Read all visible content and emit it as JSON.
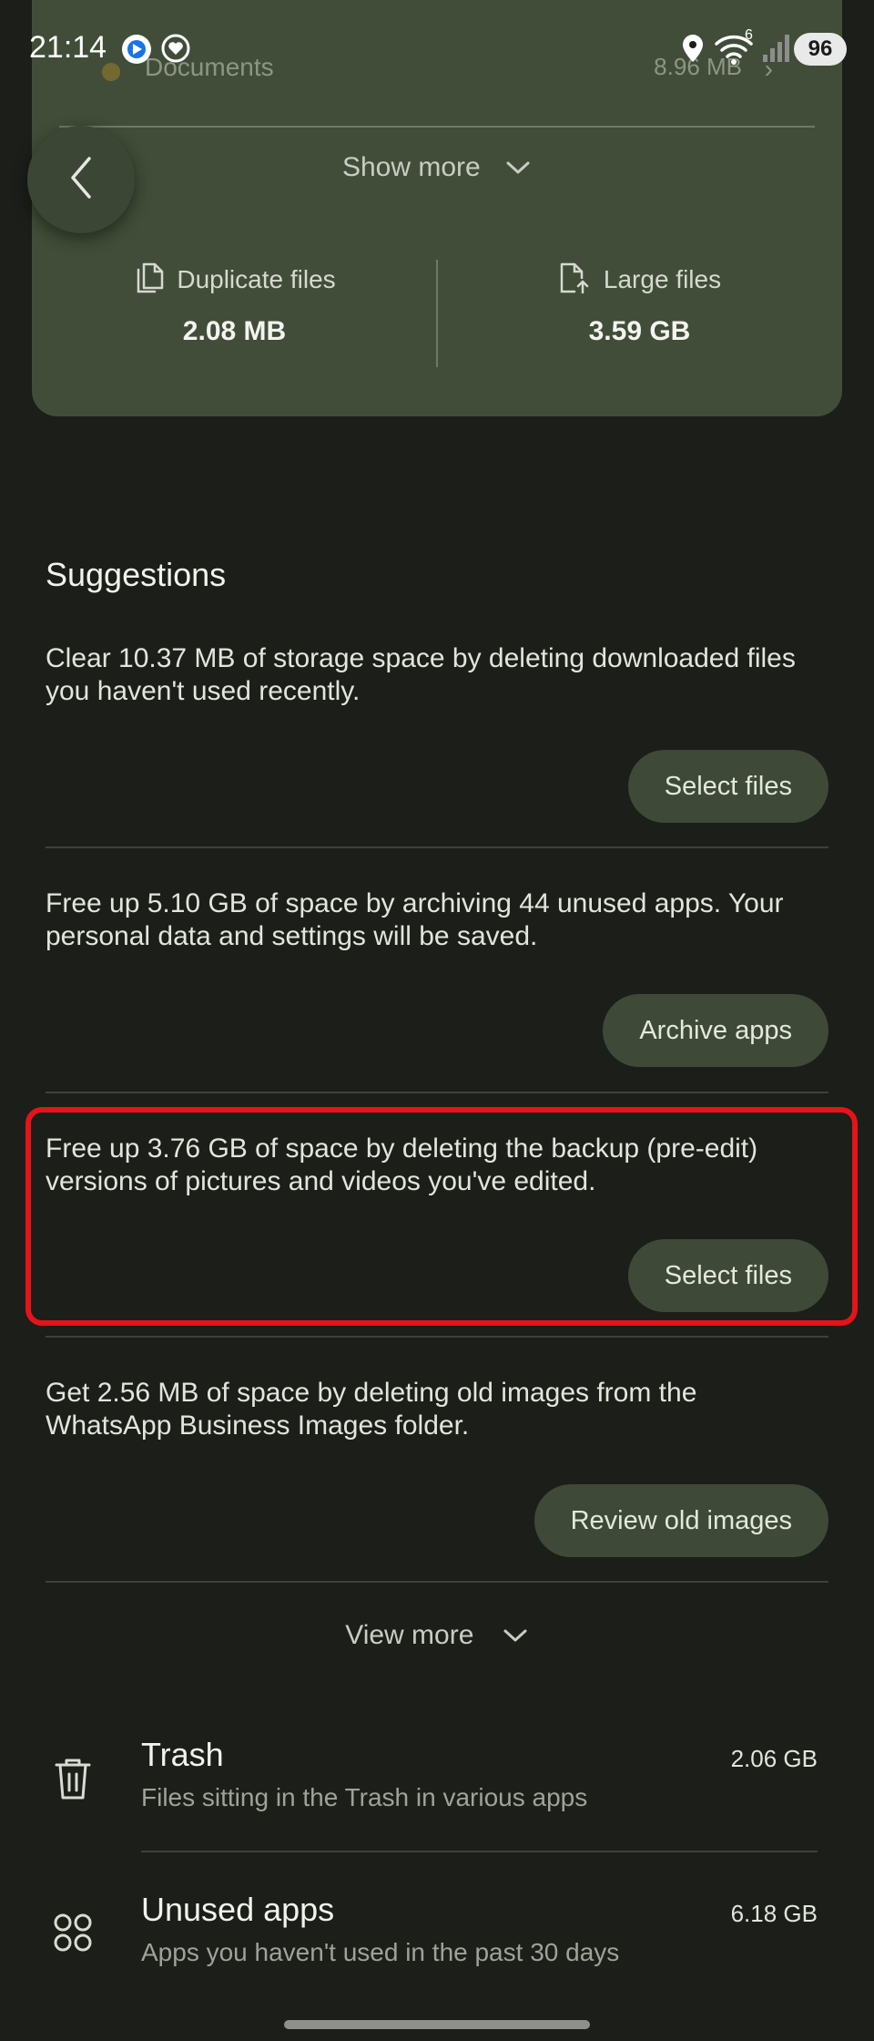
{
  "status_bar": {
    "time": "21:14",
    "battery": "96",
    "network_label": "6",
    "icons": [
      "app-notification-icon",
      "heart-notification-icon",
      "location-icon",
      "wifi-icon",
      "signal-icon"
    ]
  },
  "storage_card": {
    "documents_label": "Documents",
    "documents_size": "8.96 MB",
    "show_more": "Show more",
    "duplicate": {
      "label": "Duplicate files",
      "value": "2.08 MB"
    },
    "large": {
      "label": "Large files",
      "value": "3.59 GB"
    }
  },
  "suggestions": {
    "title": "Suggestions",
    "items": [
      {
        "text": "Clear 10.37 MB of storage space by deleting downloaded files you haven't used recently.",
        "button": "Select files"
      },
      {
        "text": "Free up 5.10 GB of space by archiving 44 unused apps. Your personal data and settings will be saved.",
        "button": "Archive apps"
      },
      {
        "text": "Free up 3.76 GB of space by deleting the backup (pre-edit) versions of pictures and videos you've edited.",
        "button": "Select files"
      },
      {
        "text": "Get 2.56 MB of space by deleting old images from the WhatsApp Business Images folder.",
        "button": "Review old images"
      }
    ],
    "view_more": "View more"
  },
  "list": [
    {
      "title": "Trash",
      "subtitle": "Files sitting in the Trash in various apps",
      "size": "2.06 GB",
      "icon": "trash-icon"
    },
    {
      "title": "Unused apps",
      "subtitle": "Apps you haven't used in the past 30 days",
      "size": "6.18 GB",
      "icon": "apps-icon"
    }
  ],
  "colors": {
    "background": "#1c1e19",
    "card": "#414d38",
    "button": "#3e4a37",
    "highlight": "#e4141a"
  }
}
